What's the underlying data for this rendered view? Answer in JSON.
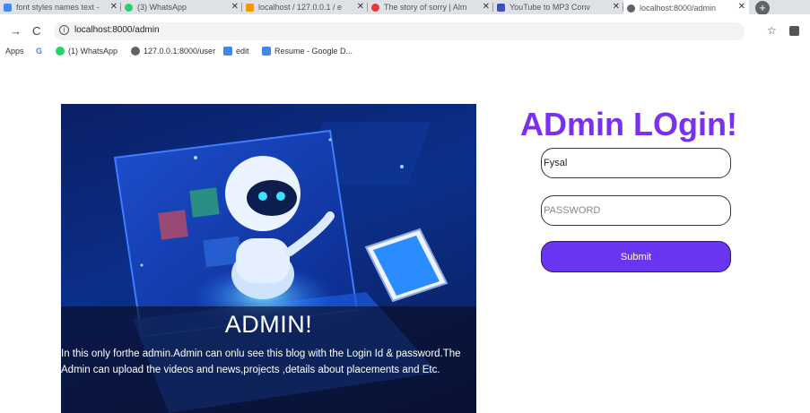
{
  "browser": {
    "tabs": [
      {
        "title": "font styles names text -",
        "color": "#4285f4",
        "active": false
      },
      {
        "title": "(3) WhatsApp",
        "color": "#25d366",
        "active": false
      },
      {
        "title": "localhost / 127.0.0.1 / e",
        "color": "#f29900",
        "active": false
      },
      {
        "title": "The story of sorry | Alm",
        "color": "#e53935",
        "active": false
      },
      {
        "title": "YouTube to MP3 Conv",
        "color": "#3f51b5",
        "active": false
      },
      {
        "title": "localhost:8000/admin",
        "color": "#5f6368",
        "active": true
      }
    ],
    "new_tab": "+",
    "url": "localhost:8000/admin",
    "bookmarks": [
      {
        "label": "Apps",
        "color": ""
      },
      {
        "label": "G",
        "color": "#4285f4"
      },
      {
        "label": "(1) WhatsApp",
        "color": "#25d366"
      },
      {
        "label": "127.0.0.1:8000/user",
        "color": "#5f6368"
      },
      {
        "label": "edit",
        "color": "#4285f4"
      },
      {
        "label": "Resume - Google D...",
        "color": "#4285f4"
      }
    ]
  },
  "hero": {
    "title": "ADMIN!",
    "description": "In this only forthe admin.Admin can onlu see this blog with the Login Id & password.The Admin can upload the videos and news,projects ,details about placements and Etc."
  },
  "login": {
    "title": "ADmin LOgin!",
    "username_value": "Fysal",
    "password_placeholder": "PASSWORD",
    "submit_label": "Submit"
  },
  "colors": {
    "accent": "#7b2ff0",
    "button": "#6a35f0"
  }
}
